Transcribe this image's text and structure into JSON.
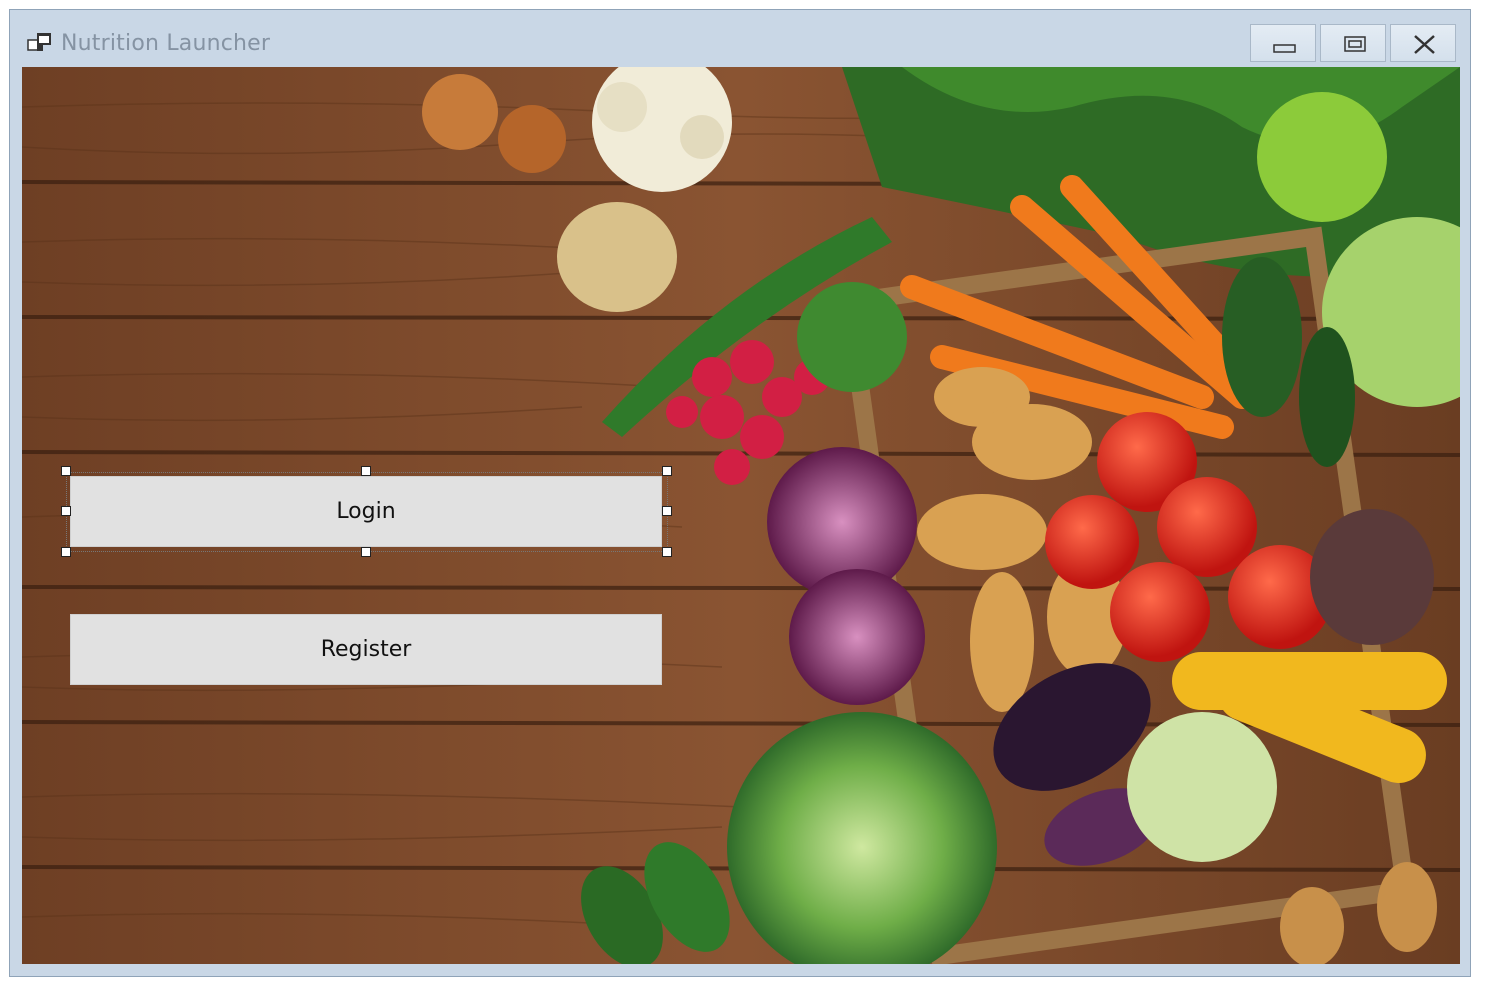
{
  "window": {
    "title": "Nutrition Launcher",
    "icon": "app-window-icon",
    "controls": [
      "minimize-icon",
      "maximize-icon",
      "close-icon"
    ]
  },
  "buttons": {
    "login_label": "Login",
    "register_label": "Register"
  },
  "background": {
    "description_icon": "vegetables-on-wood-image",
    "colors": {
      "wood": "#7a4a2e",
      "wood_dark": "#4e2d1a",
      "titlebar": "#c9d7e6"
    }
  }
}
